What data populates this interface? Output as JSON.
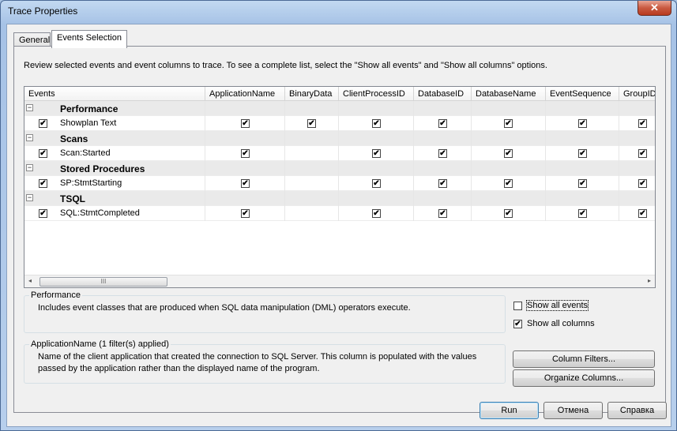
{
  "window": {
    "title": "Trace Properties",
    "close_glyph": "✕"
  },
  "tabs": [
    {
      "label": "General",
      "active": false
    },
    {
      "label": "Events Selection",
      "active": true
    }
  ],
  "intro_text": "Review selected events and event columns to trace. To see a complete list, select the \"Show all events\" and \"Show all columns\" options.",
  "grid": {
    "columns": [
      "Events",
      "ApplicationName",
      "BinaryData",
      "ClientProcessID",
      "DatabaseID",
      "DatabaseName",
      "EventSequence",
      "GroupID"
    ],
    "rows": [
      {
        "type": "category",
        "label": "Performance"
      },
      {
        "type": "event",
        "label": "Showplan Text",
        "checked": true,
        "cols": [
          true,
          true,
          true,
          true,
          true,
          true,
          true
        ]
      },
      {
        "type": "category",
        "label": "Scans"
      },
      {
        "type": "event",
        "label": "Scan:Started",
        "checked": true,
        "cols": [
          true,
          false,
          true,
          true,
          true,
          true,
          true
        ]
      },
      {
        "type": "category",
        "label": "Stored Procedures"
      },
      {
        "type": "event",
        "label": "SP:StmtStarting",
        "checked": true,
        "cols": [
          true,
          false,
          true,
          true,
          true,
          true,
          true
        ]
      },
      {
        "type": "category",
        "label": "TSQL"
      },
      {
        "type": "event",
        "label": "SQL:StmtCompleted",
        "checked": true,
        "cols": [
          true,
          false,
          true,
          true,
          true,
          true,
          true
        ]
      }
    ],
    "scroll_thumb_grip": "III"
  },
  "event_info": {
    "legend": "Performance",
    "description": "Includes event classes that are produced when SQL data manipulation (DML) operators execute."
  },
  "column_info": {
    "legend": "ApplicationName (1 filter(s) applied)",
    "description": "Name of the client application that created the connection to SQL Server. This column is populated with the values passed by the application rather than the displayed name of the program."
  },
  "options": {
    "show_all_events": {
      "label": "Show all events",
      "checked": false
    },
    "show_all_columns": {
      "label": "Show all columns",
      "checked": true
    }
  },
  "buttons": {
    "column_filters": "Column Filters...",
    "organize_columns": "Organize Columns...",
    "run": "Run",
    "cancel": "Отмена",
    "help": "Справка"
  },
  "check_glyph": "✔",
  "expander_glyph": "−"
}
